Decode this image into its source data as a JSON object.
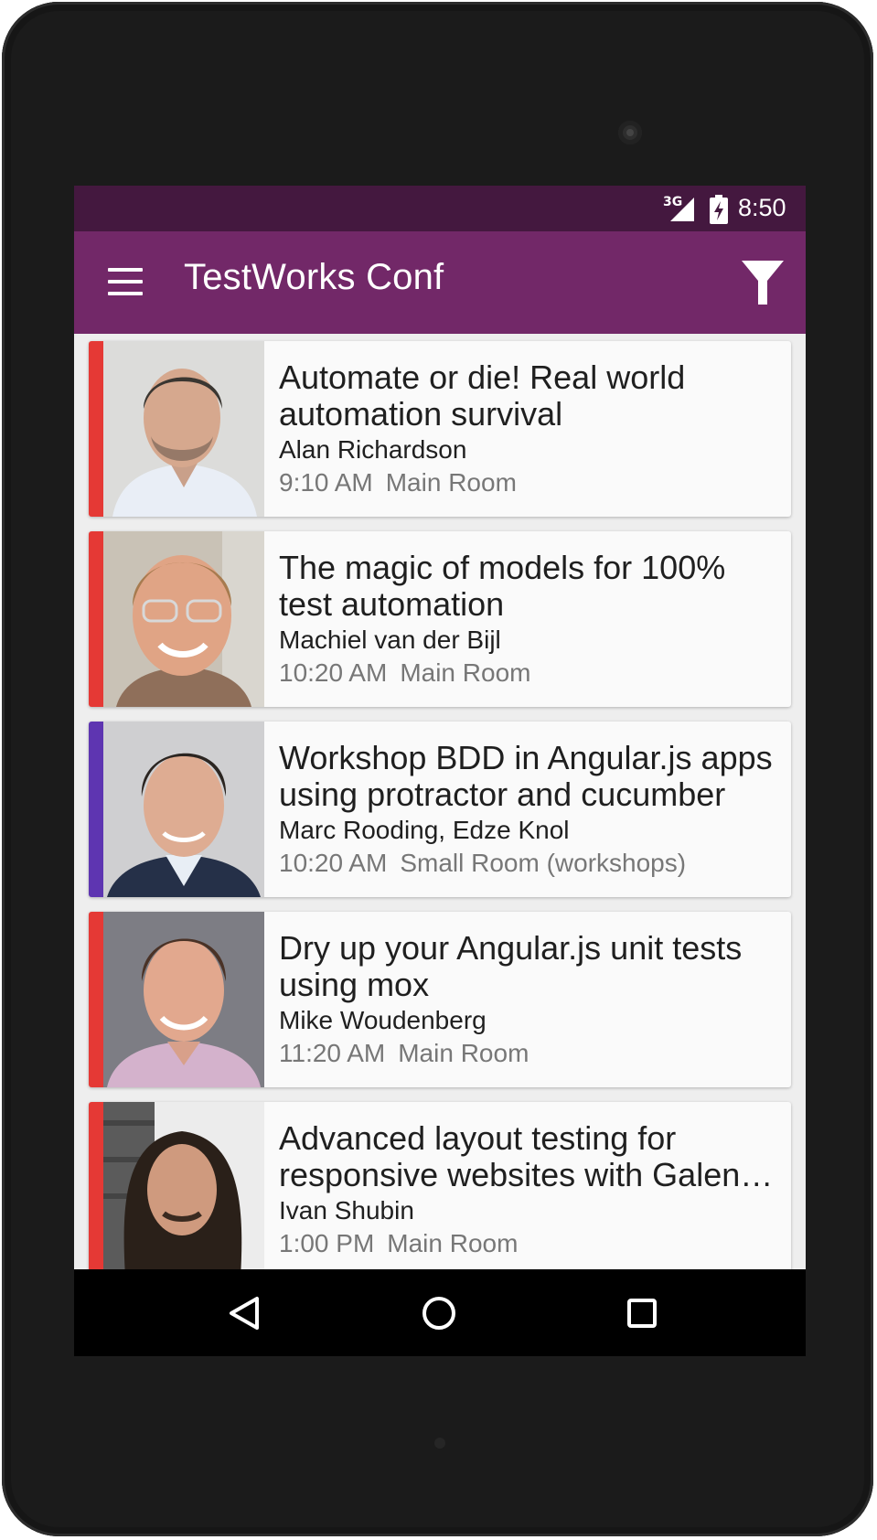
{
  "status_bar": {
    "network": "3G",
    "time": "8:50"
  },
  "app_bar": {
    "title": "TestWorks Conf",
    "menu_icon": "hamburger-menu-icon",
    "filter_icon": "filter-icon",
    "color": "#722868"
  },
  "sessions": [
    {
      "title": "Automate or die! Real world automation survival",
      "speaker": "Alan Richardson",
      "time": "9:10 AM",
      "room": "Main Room",
      "accent": "#e53935"
    },
    {
      "title": "The magic of models for 100% test automation",
      "speaker": "Machiel van der Bijl",
      "time": "10:20 AM",
      "room": "Main Room",
      "accent": "#e53935"
    },
    {
      "title": "Workshop BDD in Angular.js apps using protractor and cucumber",
      "speaker": "Marc Rooding, Edze Knol",
      "time": "10:20 AM",
      "room": "Small Room (workshops)",
      "accent": "#5e35b1"
    },
    {
      "title": "Dry up your Angular.js unit tests using mox",
      "speaker": "Mike Woudenberg",
      "time": "11:20 AM",
      "room": "Main Room",
      "accent": "#e53935"
    },
    {
      "title": "Advanced layout testing for responsive websites with Galen…",
      "speaker": "Ivan Shubin",
      "time": "1:00 PM",
      "room": "Main Room",
      "accent": "#e53935"
    }
  ],
  "nav_bar": {
    "back_icon": "back-triangle-icon",
    "home_icon": "home-circle-icon",
    "recents_icon": "recents-square-icon"
  }
}
